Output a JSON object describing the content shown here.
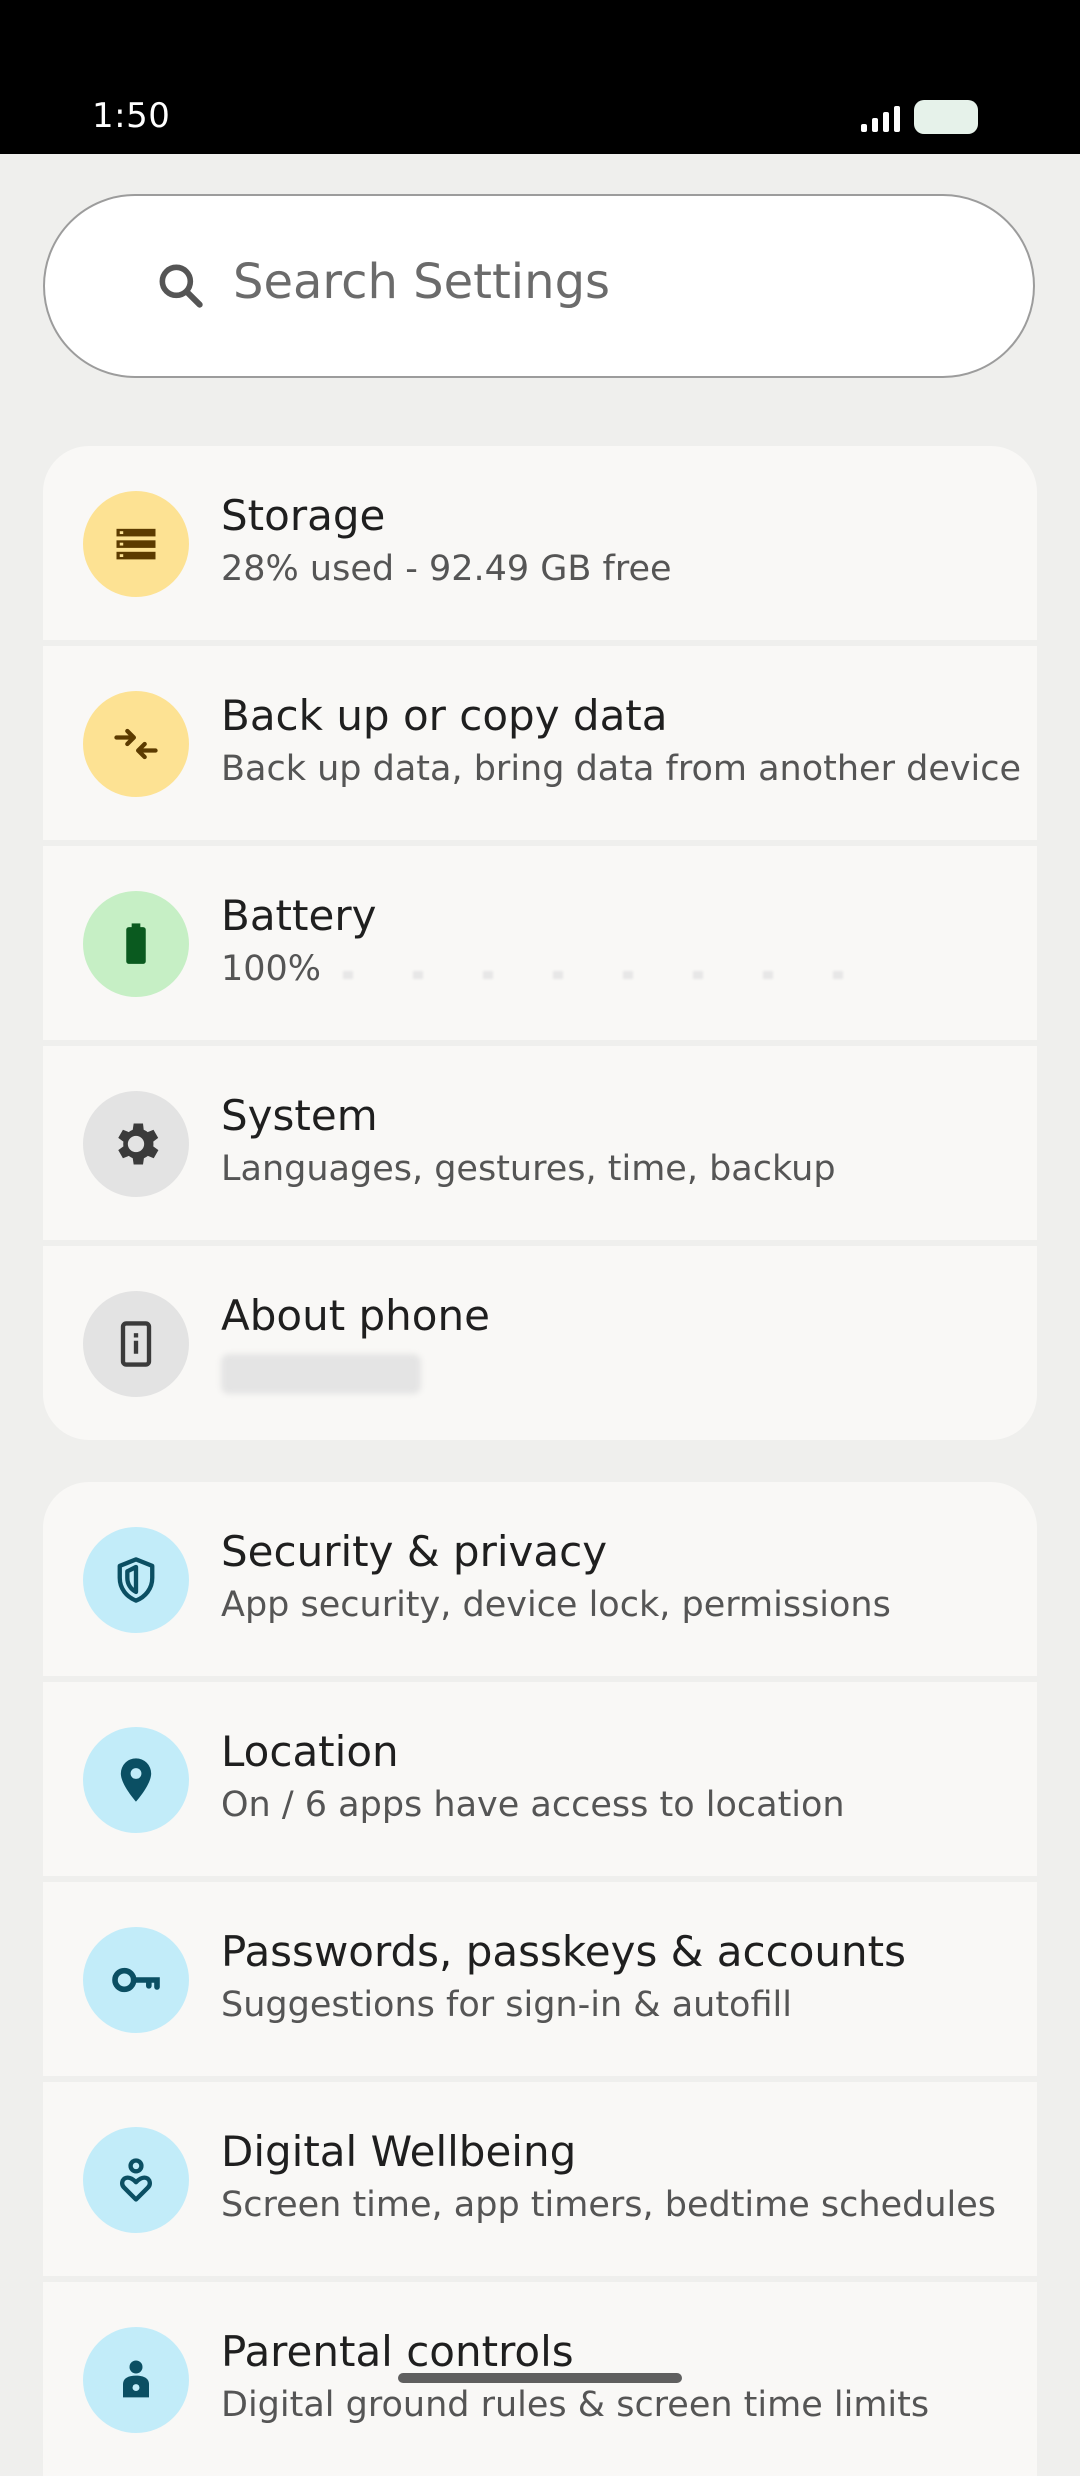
{
  "status_bar": {
    "time": "1:50"
  },
  "search": {
    "placeholder": "Search Settings"
  },
  "groups": [
    {
      "items": [
        {
          "title": "Storage",
          "subtitle": "28% used - 92.49 GB free",
          "icon": "storage-icon",
          "icon_bg": "#fde293",
          "icon_color": "#5c3b00"
        },
        {
          "title": "Back up or copy data",
          "subtitle": "Back up data, bring data from another device",
          "icon": "swap-icon",
          "icon_bg": "#fde293",
          "icon_color": "#5c3b00"
        },
        {
          "title": "Battery",
          "subtitle": "100%",
          "icon": "battery-icon",
          "icon_bg": "#c6efc5",
          "icon_color": "#0a5a1f"
        },
        {
          "title": "System",
          "subtitle": "Languages, gestures, time, backup",
          "icon": "gear-icon",
          "icon_bg": "#e3e3e3",
          "icon_color": "#3b3b3b"
        },
        {
          "title": "About phone",
          "subtitle": "",
          "icon": "phone-info-icon",
          "icon_bg": "#e3e3e3",
          "icon_color": "#3b3b3b"
        }
      ]
    },
    {
      "items": [
        {
          "title": "Security & privacy",
          "subtitle": "App security, device lock, permissions",
          "icon": "shield-icon",
          "icon_bg": "#c2ecf9",
          "icon_color": "#0b4f63"
        },
        {
          "title": "Location",
          "subtitle": "On / 6 apps have access to location",
          "icon": "location-pin-icon",
          "icon_bg": "#c2ecf9",
          "icon_color": "#0b4f63"
        },
        {
          "title": "Passwords, passkeys & accounts",
          "subtitle": "Suggestions for sign-in & autofill",
          "icon": "key-icon",
          "icon_bg": "#c2ecf9",
          "icon_color": "#0b4f63"
        },
        {
          "title": "Digital Wellbeing",
          "subtitle": "Screen time, app timers, bedtime schedules",
          "icon": "wellbeing-icon",
          "icon_bg": "#c2ecf9",
          "icon_color": "#0b4f63"
        },
        {
          "title": "Parental controls",
          "subtitle": "Digital ground rules & screen time limits",
          "icon": "parental-icon",
          "icon_bg": "#c2ecf9",
          "icon_color": "#0b4f63"
        }
      ]
    }
  ]
}
